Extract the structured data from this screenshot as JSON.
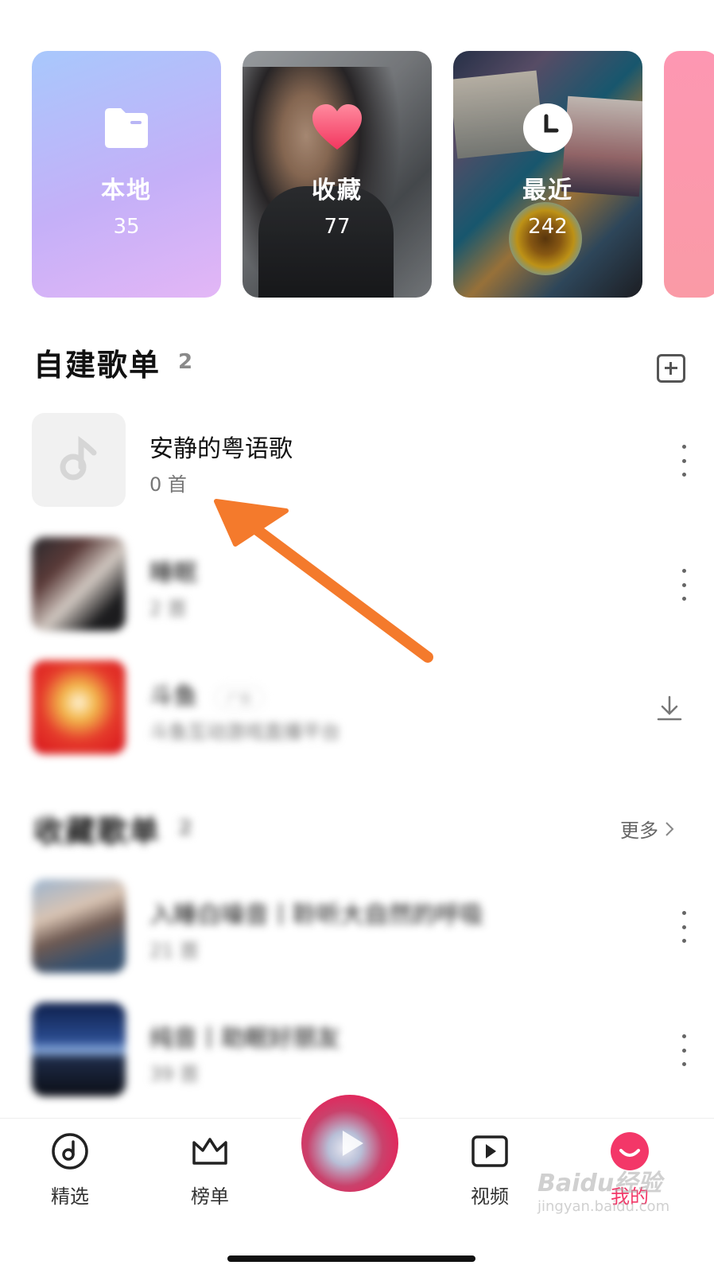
{
  "quick_cards": [
    {
      "title": "本地",
      "count": "35",
      "icon": "folder-icon"
    },
    {
      "title": "收藏",
      "count": "77",
      "icon": "heart-icon"
    },
    {
      "title": "最近",
      "count": "242",
      "icon": "clock-icon"
    }
  ],
  "my_playlists": {
    "title": "自建歌单",
    "count": "2",
    "add_icon": "add-square-icon",
    "items": [
      {
        "title": "安静的粤语歌",
        "subtitle": "0 首",
        "icon": "music-note-icon"
      },
      {
        "title": "睡眠",
        "subtitle": "2 首"
      }
    ]
  },
  "ad": {
    "title": "斗鱼",
    "tag": "广告",
    "subtitle": "斗鱼互动游戏直播平台",
    "action_icon": "download-icon"
  },
  "fav_playlists": {
    "title": "收藏歌单",
    "count": "2",
    "more_label": "更多",
    "items": [
      {
        "title": "入睡白噪音丨聆听大自然的呼吸",
        "subtitle": "21 首"
      },
      {
        "title": "纯音丨助眠好朋友",
        "subtitle": "39 首"
      }
    ]
  },
  "bottom_nav": [
    {
      "label": "精选",
      "icon": "disc-icon"
    },
    {
      "label": "榜单",
      "icon": "crown-icon"
    },
    {
      "label": "视频",
      "icon": "video-play-icon"
    },
    {
      "label": "我的",
      "icon": "smile-icon"
    }
  ],
  "watermark": {
    "text": "Baidu经验",
    "sub": "jingyan.baidu.com"
  },
  "colors": {
    "accent": "#f33768",
    "arrow": "#f47a2c"
  }
}
